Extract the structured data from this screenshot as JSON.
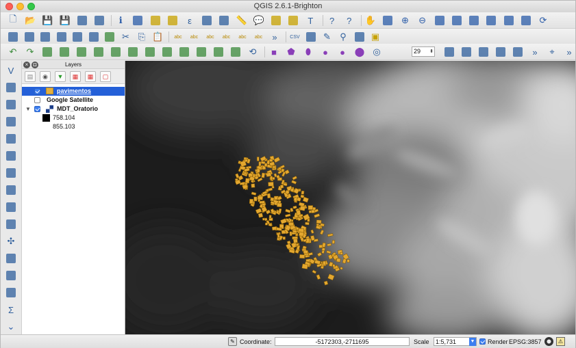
{
  "window": {
    "title": "QGIS 2.6.1-Brighton"
  },
  "layers_panel": {
    "title": "Layers",
    "layers": [
      {
        "name": "pavimentos",
        "checked": true,
        "selected": true,
        "swatch_color": "#e3b040"
      },
      {
        "name": "Google Satellite",
        "checked": false,
        "selected": false
      },
      {
        "name": "MDT_Oratorio",
        "checked": true,
        "selected": false,
        "expanded": true,
        "legend": [
          {
            "label": "758.104",
            "color": "#000000"
          },
          {
            "label": "855.103",
            "color": "#ffffff"
          }
        ]
      }
    ]
  },
  "toolbar": {
    "zoom_field_value": "29"
  },
  "statusbar": {
    "coordinate_label": "Coordinate:",
    "coordinate_value": "-5172303,-2711695",
    "scale_label": "Scale",
    "scale_value": "1:5,731",
    "render_label": "Render",
    "render_checked": true,
    "crs_label": "EPSG:3857"
  },
  "colors": {
    "selection": "#2460d8",
    "feature_fill": "#e3a72f",
    "feature_outline": "#7a5300",
    "checkbox": "#3c7ef0"
  },
  "icons": {
    "toolbar1": [
      "new-project-icon",
      "open-project-icon",
      "save-project-icon",
      "save-as-icon",
      "new-print-composer-icon",
      "composer-manager-icon",
      "identify-icon",
      "zoom-select-icon",
      "select-features-icon",
      "deselect-icon",
      "expression-icon",
      "attribute-table-icon",
      "field-calculator-icon",
      "measure-icon",
      "map-tips-icon",
      "new-bookmark-icon",
      "show-bookmarks-icon",
      "text-annotation-icon",
      "help-icon",
      "whats-this-icon",
      "pan-icon",
      "pan-to-selection-icon",
      "zoom-in-icon",
      "zoom-out-icon",
      "zoom-full-icon",
      "zoom-layer-icon",
      "zoom-selection-icon",
      "zoom-last-icon",
      "zoom-next-icon",
      "zoom-native-icon",
      "refresh-icon"
    ],
    "toolbar2": [
      "current-edits-icon",
      "toggle-editing-icon",
      "save-edits-icon",
      "add-feature-icon",
      "move-feature-icon",
      "node-tool-icon",
      "delete-selected-icon",
      "cut-features-icon",
      "copy-features-icon",
      "paste-features-icon",
      "label-icon",
      "label-pin-icon",
      "label-highlight-icon",
      "label-move-icon",
      "label-rotate-icon",
      "label-change-icon",
      "more-icon",
      "csv-icon",
      "open-street-map-icon",
      "digitize-icon",
      "binoculars-icon",
      "plugin-icon",
      "sticky-note-icon"
    ],
    "toolbar3": [
      "undo-icon",
      "redo-icon",
      "simplify-icon",
      "add-ring-icon",
      "add-part-icon",
      "fill-ring-icon",
      "delete-ring-icon",
      "delete-part-icon",
      "reshape-icon",
      "offset-curve-icon",
      "split-features-icon",
      "split-parts-icon",
      "merge-features-icon",
      "merge-attributes-icon",
      "rotate-point-icon",
      "rectangle-icon",
      "regular-shape-icon",
      "ellipse-icon",
      "circle-icon",
      "circle-filled-icon",
      "ellipse-filled-icon",
      "spiral-icon",
      "zoom-spinbox-icon",
      "layer-settings-icon",
      "copy-style-icon",
      "paste-style-icon",
      "add-vertex-icon",
      "add-layer-icon",
      "more-icon",
      "tracing-icon",
      "more-icon"
    ],
    "left_tools": [
      "add-vector-layer-icon",
      "add-raster-layer-icon",
      "add-postgis-layer-icon",
      "add-spatialite-layer-icon",
      "add-mssql-layer-icon",
      "add-wms-layer-icon",
      "add-wcs-layer-icon",
      "add-wfs-layer-icon",
      "add-delimited-text-icon",
      "new-shapefile-icon",
      "gps-icon",
      "georeferencer-icon",
      "vector-digitize-icon",
      "raster-calc-icon",
      "sum-icon",
      "expand-icon"
    ],
    "layers_panel_tools": [
      "add-group-icon",
      "manage-visibility-icon",
      "filter-legend-icon",
      "expand-all-icon",
      "collapse-all-icon",
      "remove-layer-icon"
    ]
  }
}
